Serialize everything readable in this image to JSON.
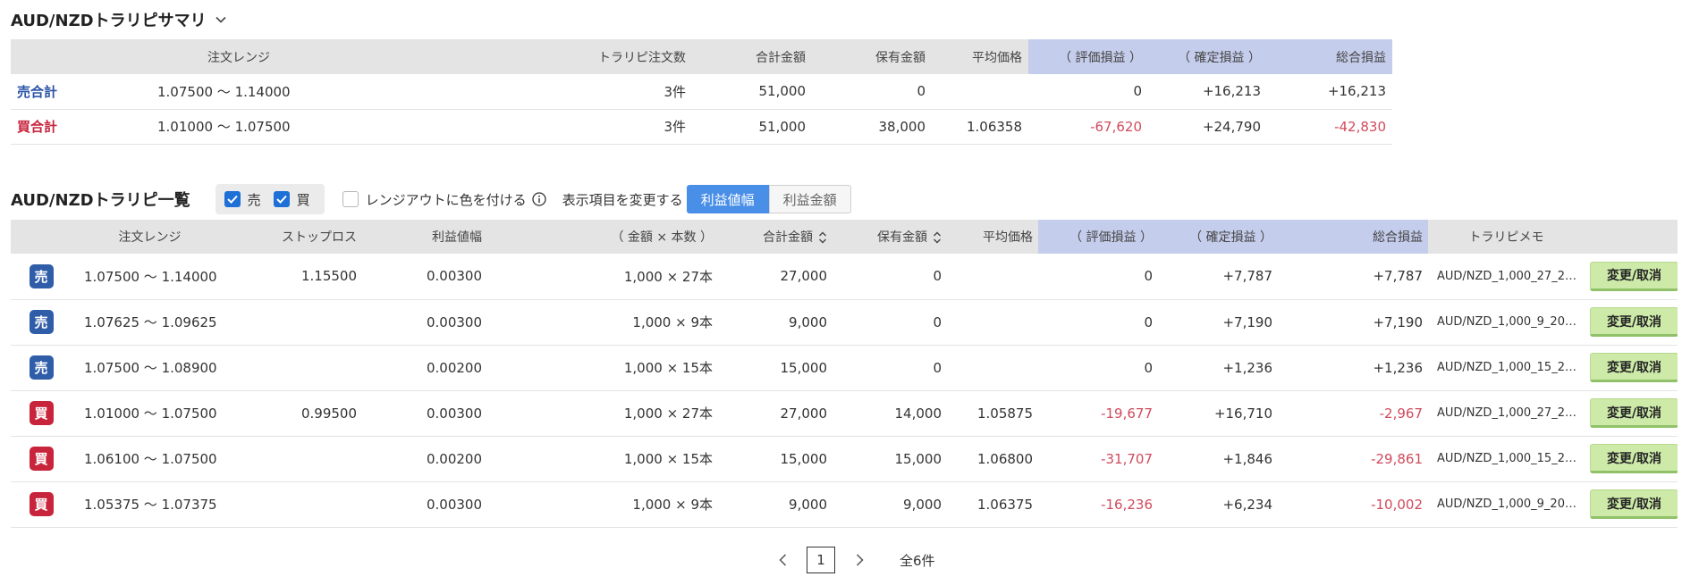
{
  "summary": {
    "title": "AUD/NZDトラリピサマリ",
    "columns": [
      "注文レンジ",
      "トラリピ注文数",
      "合計金額",
      "保有金額",
      "平均価格",
      "（ 評価損益 ）",
      "（ 確定損益 ）",
      "総合損益"
    ],
    "rows": [
      {
        "side": "売合計",
        "range": "1.07500 〜 1.14000",
        "count": "3件",
        "total": "51,000",
        "held": "0",
        "avg": "",
        "unrealized": "0",
        "realized": "+16,213",
        "overall": "+16,213"
      },
      {
        "side": "買合計",
        "range": "1.01000 〜 1.07500",
        "count": "3件",
        "total": "51,000",
        "held": "38,000",
        "avg": "1.06358",
        "unrealized": "-67,620",
        "realized": "+24,790",
        "overall": "-42,830"
      }
    ]
  },
  "list": {
    "title": "AUD/NZDトラリピ一覧",
    "filter_sell": "売",
    "filter_buy": "買",
    "range_out_label": "レンジアウトに色を付ける",
    "display_label": "表示項目を変更する",
    "display_options": [
      "利益値幅",
      "利益金額"
    ],
    "columns": [
      "注文レンジ",
      "ストップロス",
      "利益値幅",
      "（ 金額 × 本数 ）",
      "合計金額",
      "保有金額",
      "平均価格",
      "（ 評価損益 ）",
      "（ 確定損益 ）",
      "総合損益",
      "トラリピメモ"
    ],
    "action_label": "変更/取消",
    "rows": [
      {
        "side": "売",
        "range": "1.07500 〜 1.14000",
        "stop": "1.15500",
        "width": "0.00300",
        "amount": "1,000 × 27本",
        "total": "27,000",
        "held": "0",
        "avg": "",
        "unrealized": "0",
        "realized": "+7,787",
        "overall": "+7,787",
        "memo": "AUD/NZD_1,000_27_2…"
      },
      {
        "side": "売",
        "range": "1.07625 〜 1.09625",
        "stop": "",
        "width": "0.00300",
        "amount": "1,000 × 9本",
        "total": "9,000",
        "held": "0",
        "avg": "",
        "unrealized": "0",
        "realized": "+7,190",
        "overall": "+7,190",
        "memo": "AUD/NZD_1,000_9_20…"
      },
      {
        "side": "売",
        "range": "1.07500 〜 1.08900",
        "stop": "",
        "width": "0.00200",
        "amount": "1,000 × 15本",
        "total": "15,000",
        "held": "0",
        "avg": "",
        "unrealized": "0",
        "realized": "+1,236",
        "overall": "+1,236",
        "memo": "AUD/NZD_1,000_15_2…"
      },
      {
        "side": "買",
        "range": "1.01000 〜 1.07500",
        "stop": "0.99500",
        "width": "0.00300",
        "amount": "1,000 × 27本",
        "total": "27,000",
        "held": "14,000",
        "avg": "1.05875",
        "unrealized": "-19,677",
        "realized": "+16,710",
        "overall": "-2,967",
        "memo": "AUD/NZD_1,000_27_2…"
      },
      {
        "side": "買",
        "range": "1.06100 〜 1.07500",
        "stop": "",
        "width": "0.00200",
        "amount": "1,000 × 15本",
        "total": "15,000",
        "held": "15,000",
        "avg": "1.06800",
        "unrealized": "-31,707",
        "realized": "+1,846",
        "overall": "-29,861",
        "memo": "AUD/NZD_1,000_15_2…"
      },
      {
        "side": "買",
        "range": "1.05375 〜 1.07375",
        "stop": "",
        "width": "0.00300",
        "amount": "1,000 × 9本",
        "total": "9,000",
        "held": "9,000",
        "avg": "1.06375",
        "unrealized": "-16,236",
        "realized": "+6,234",
        "overall": "-10,002",
        "memo": "AUD/NZD_1,000_9_20…"
      }
    ]
  },
  "pagination": {
    "current": "1",
    "total": "全6件"
  },
  "colors": {
    "sell": "#2c54a7",
    "buy": "#c8243c",
    "negative": "#d04a5c",
    "accent": "#4a8fe7",
    "header_highlight": "#c5cdec",
    "action_button": "#cdeaa9"
  },
  "icons": {
    "title_toggle": "chevron-down-icon",
    "info": "info-circle-icon",
    "sort": "sort-updown-icon",
    "check": "check-icon",
    "prev": "chevron-left-icon",
    "next": "chevron-right-icon"
  }
}
